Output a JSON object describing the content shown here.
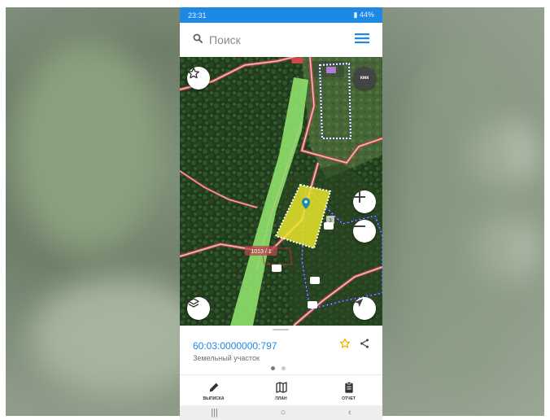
{
  "status_bar": {
    "time": "23:31",
    "right_text": "44%"
  },
  "search": {
    "placeholder": "Поиск"
  },
  "map": {
    "labels": {
      "parcel_label": "1013 / 1",
      "overlay_number": "3",
      "kmk": "кмк"
    }
  },
  "parcel": {
    "id": "60:03:0000000:797",
    "type": "Земельный участок"
  },
  "bottom_nav": [
    {
      "label": "ВЫПИСКА",
      "icon": "pencil-icon"
    },
    {
      "label": "ПЛАН",
      "icon": "map-icon"
    },
    {
      "label": "ОТЧЕТ",
      "icon": "clipboard-icon"
    }
  ],
  "colors": {
    "accent": "#1e88e5",
    "highlight": "#e8e52c",
    "route": "#8fe06b",
    "boundary": "#f2a0a0",
    "star": "#f2b600"
  },
  "system_nav": {
    "recents": "|||",
    "home": "○",
    "back": "‹"
  }
}
